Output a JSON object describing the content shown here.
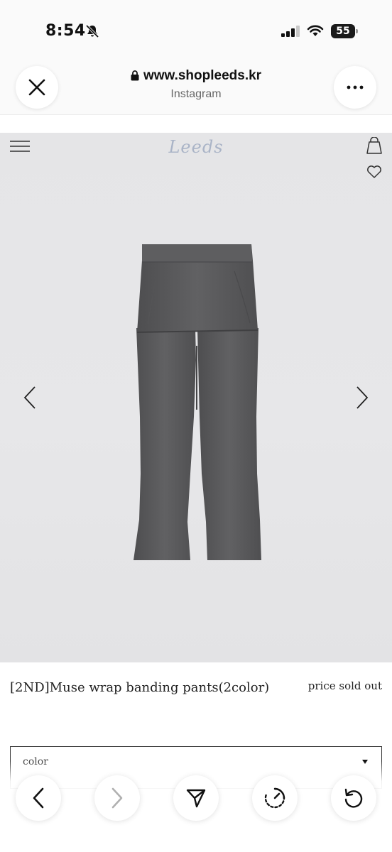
{
  "status_bar": {
    "time": "8:54",
    "battery": "55",
    "icons": [
      "bell-slash-icon",
      "cellular-signal-icon",
      "wifi-icon",
      "battery-icon"
    ]
  },
  "browser": {
    "url": "www.shopleeds.kr",
    "source": "Instagram",
    "icons": [
      "close-icon",
      "lock-icon",
      "more-icon"
    ]
  },
  "site": {
    "logo": "Leeds",
    "icons": [
      "hamburger-menu-icon",
      "shopping-bag-icon",
      "heart-icon",
      "chevron-left-icon",
      "chevron-right-icon"
    ]
  },
  "product": {
    "name": "[2ND]Muse wrap banding pants(2color)",
    "price_status": "price sold out",
    "image_subject": "grey skirt-layered flare pants",
    "garment_color": "#5a5a5c"
  },
  "option": {
    "label": "color"
  },
  "toolbar": {
    "icons": [
      "back-icon",
      "forward-icon",
      "share-icon",
      "speed-icon",
      "reload-icon"
    ]
  },
  "colors": {
    "image_background": "#e6e6e8",
    "logo": "#aab4c7",
    "text": "#222222"
  }
}
